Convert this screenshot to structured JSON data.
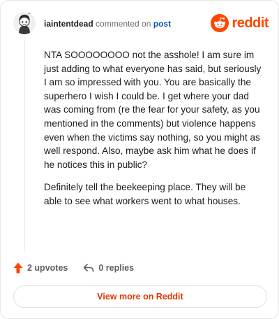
{
  "header": {
    "username": "iaintentdead",
    "commented_text": "commented on",
    "post_link": "post",
    "brand_name": "reddit"
  },
  "comment": {
    "paragraphs": [
      "NTA SOOOOOOOO not the asshole! I am sure im just adding to what everyone has said, but seriously I am so impressed with you. You are basically the superhero I wish I could be. I get where your dad was coming from (re the fear for your safety, as you mentioned in the comments) but violence happens even when the victims say nothing, so you might as well respond. Also, maybe ask him what he does if he notices this in public?",
      "Definitely tell the beekeeping place. They will be able to see what workers went to what houses."
    ]
  },
  "actions": {
    "upvotes": "2 upvotes",
    "replies": "0 replies"
  },
  "footer": {
    "view_more_label": "View more on Reddit"
  },
  "colors": {
    "brand": "#ff4500",
    "upvote": "#ff4500",
    "link": "#0b57b4",
    "view_more_text": "#d93a00"
  },
  "icons": {
    "avatar": "snoo-avatar-icon",
    "brand": "reddit-logo-icon",
    "upvote": "upvote-arrow-icon",
    "reply": "reply-arrow-icon"
  }
}
